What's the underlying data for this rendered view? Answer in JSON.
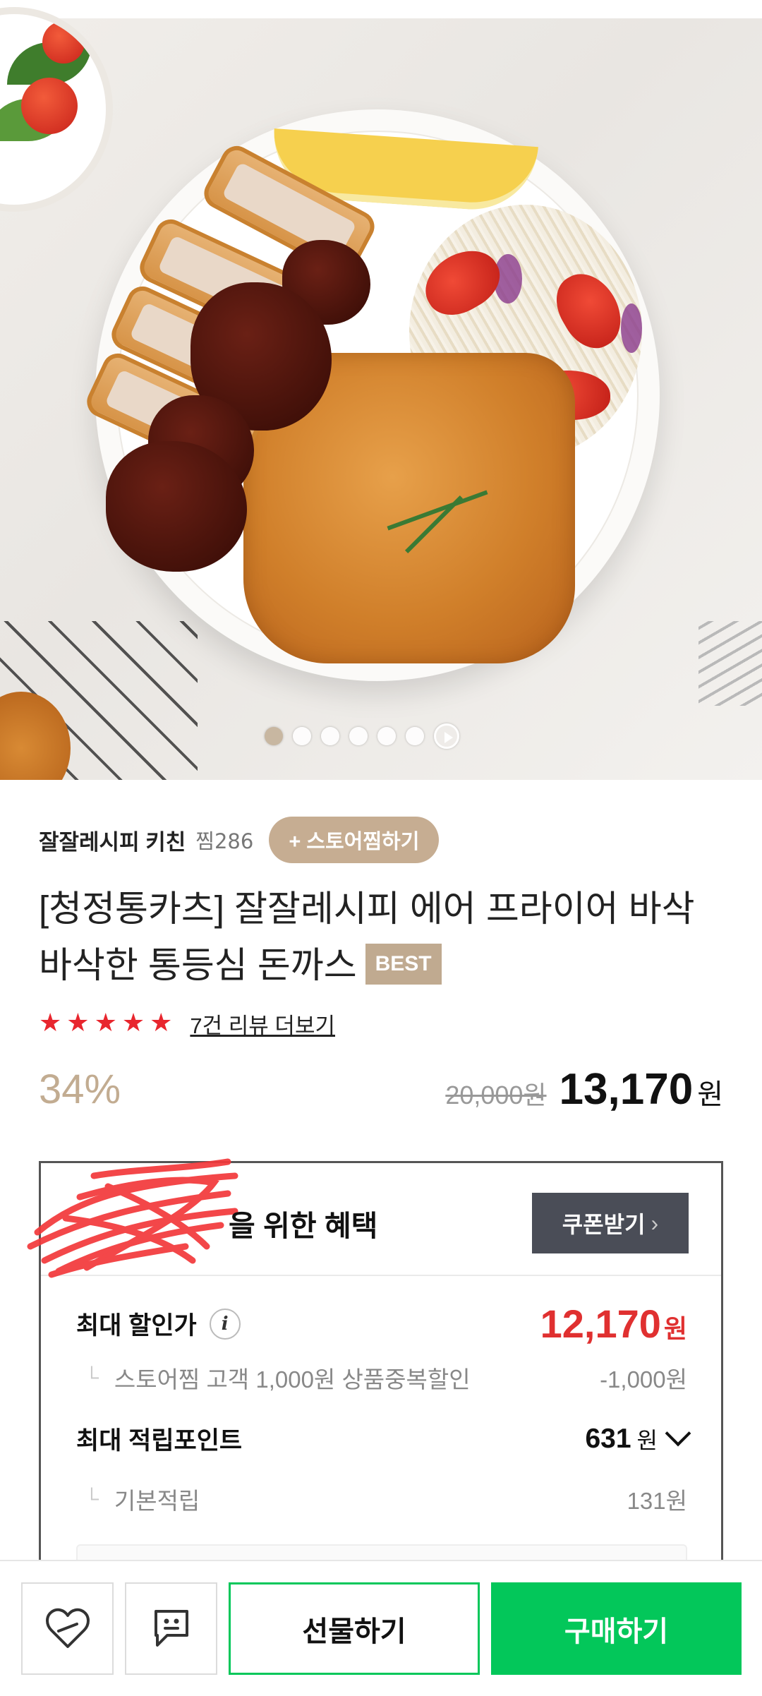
{
  "hero": {
    "image_alt": "돈까스 상품 이미지",
    "slide_count": 6,
    "active_slide": 1
  },
  "store": {
    "name": "잘잘레시피 키친",
    "zzim": "찜286",
    "fav_button": "+ 스토어찜하기"
  },
  "product": {
    "title": "[청정통카츠] 잘잘레시피 에어 프라이어 바삭 바삭한 통등심 돈까스",
    "badge": "BEST",
    "rating_stars": 5,
    "review_link": "7건 리뷰 더보기",
    "discount_rate": "34%",
    "original_price": "20,000원",
    "sale_price": "13,170",
    "currency": "원"
  },
  "benefits": {
    "title_suffix": "을 위한 혜택",
    "coupon_button": "쿠폰받기",
    "max_discount_label": "최대 할인가",
    "max_discount_price": "12,170",
    "max_discount_currency": "원",
    "store_zzim_discount_label": "스토어찜 고객 1,000원 상품중복할인",
    "store_zzim_discount_value": "-1,000원",
    "max_points_label": "최대 적립포인트",
    "max_points_value": "631",
    "max_points_unit": "원",
    "base_points_label": "기본적립",
    "base_points_value": "131원"
  },
  "bottom_bar": {
    "gift_button": "선물하기",
    "buy_button": "구매하기"
  },
  "colors": {
    "accent_beige": "#c6ad92",
    "naver_green": "#03c75a",
    "price_red": "#e03030",
    "star_red": "#e8262e"
  }
}
